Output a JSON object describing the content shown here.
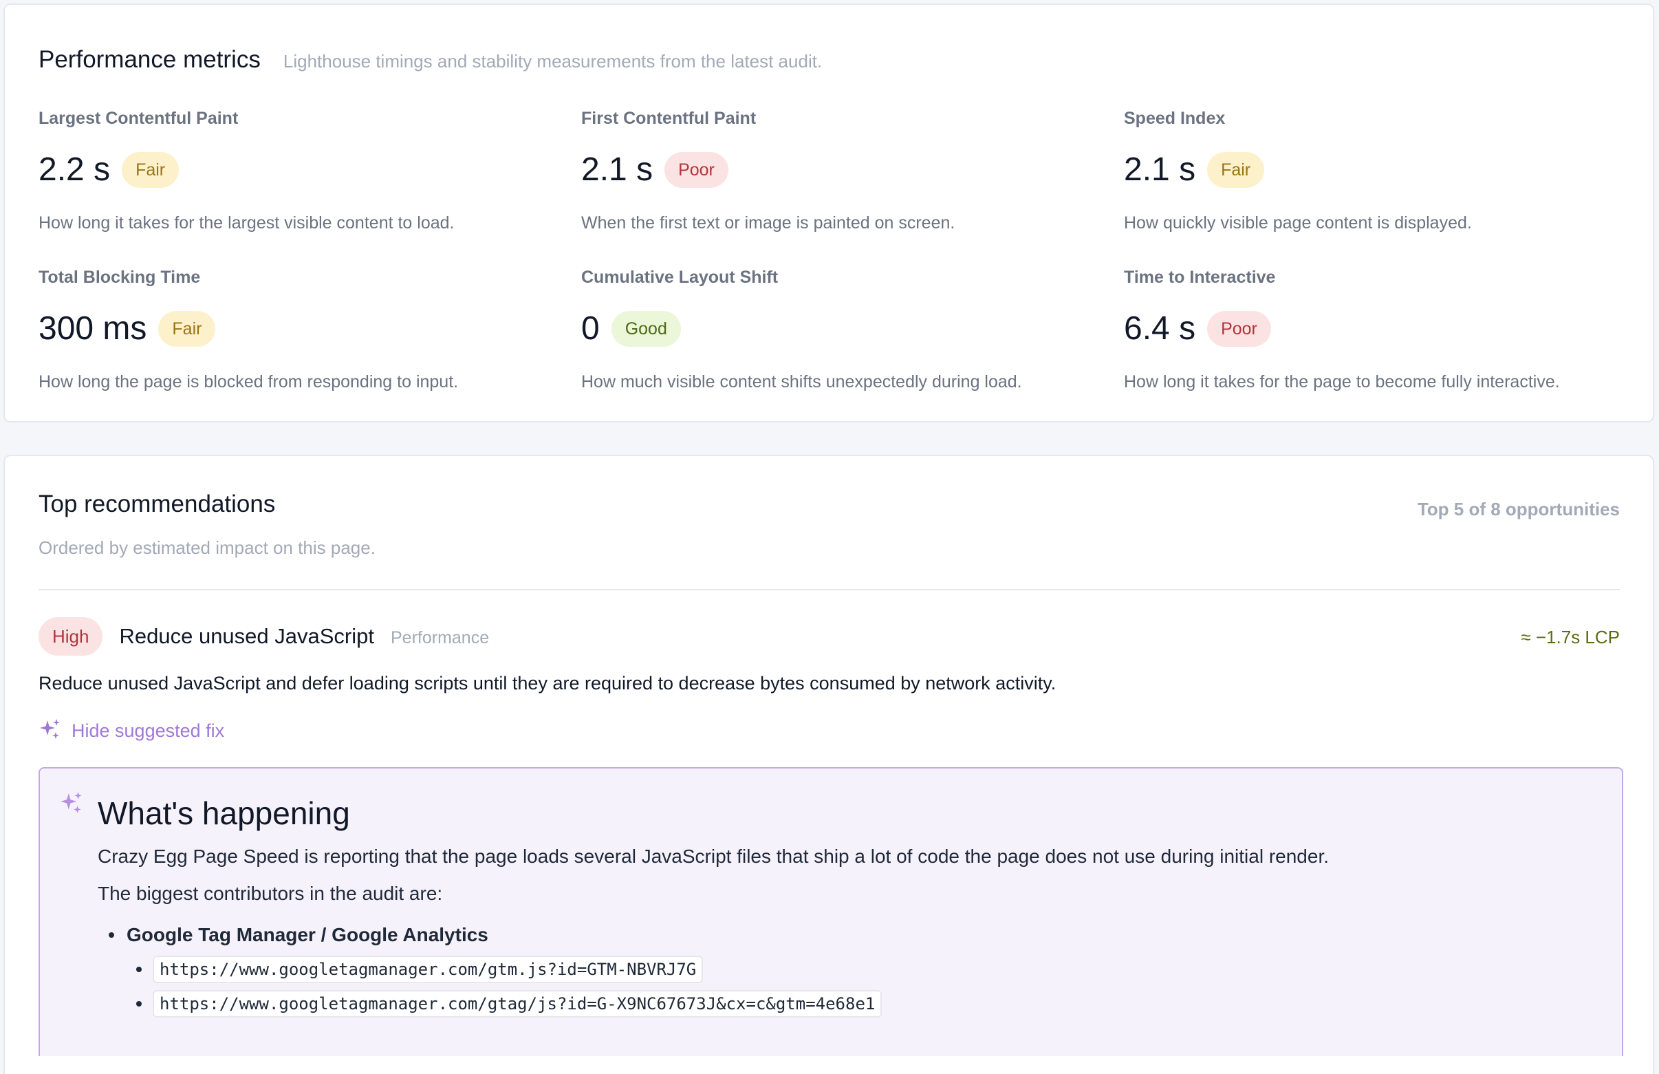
{
  "metrics_card": {
    "title": "Performance metrics",
    "subtitle": "Lighthouse timings and stability measurements from the latest audit.",
    "metrics": [
      {
        "label": "Largest Contentful Paint",
        "value": "2.2 s",
        "rating": "Fair",
        "description": "How long it takes for the largest visible content to load."
      },
      {
        "label": "First Contentful Paint",
        "value": "2.1 s",
        "rating": "Poor",
        "description": "When the first text or image is painted on screen."
      },
      {
        "label": "Speed Index",
        "value": "2.1 s",
        "rating": "Fair",
        "description": "How quickly visible page content is displayed."
      },
      {
        "label": "Total Blocking Time",
        "value": "300 ms",
        "rating": "Fair",
        "description": "How long the page is blocked from responding to input."
      },
      {
        "label": "Cumulative Layout Shift",
        "value": "0",
        "rating": "Good",
        "description": "How much visible content shifts unexpectedly during load."
      },
      {
        "label": "Time to Interactive",
        "value": "6.4 s",
        "rating": "Poor",
        "description": "How long it takes for the page to become fully interactive."
      }
    ]
  },
  "recommendations": {
    "title": "Top recommendations",
    "subtitle": "Ordered by estimated impact on this page.",
    "count_label": "Top 5 of 8 opportunities",
    "items": [
      {
        "priority": "High",
        "title": "Reduce unused JavaScript",
        "category": "Performance",
        "impact": "≈ −1.7s LCP",
        "description": "Reduce unused JavaScript and defer loading scripts until they are required to decrease bytes consumed by network activity.",
        "fix_toggle_label": "Hide suggested fix",
        "fix": {
          "heading": "What's happening",
          "paragraph_1": "Crazy Egg Page Speed is reporting that the page loads several JavaScript files that ship a lot of code the page does not use during initial render.",
          "paragraph_2": "The biggest contributors in the audit are:",
          "contributors": [
            {
              "name": "Google Tag Manager / Google Analytics",
              "urls": [
                "https://www.googletagmanager.com/gtm.js?id=GTM-NBVRJ7G",
                "https://www.googletagmanager.com/gtag/js?id=G-X9NC67673J&cx=c&gtm=4e68e1"
              ]
            }
          ]
        }
      }
    ]
  },
  "icons": {
    "sparkle": "sparkles-icon"
  },
  "colors": {
    "fair": "#9a7413",
    "poor": "#b2343b",
    "good": "#4c6b17",
    "accent": "#a078d8"
  }
}
